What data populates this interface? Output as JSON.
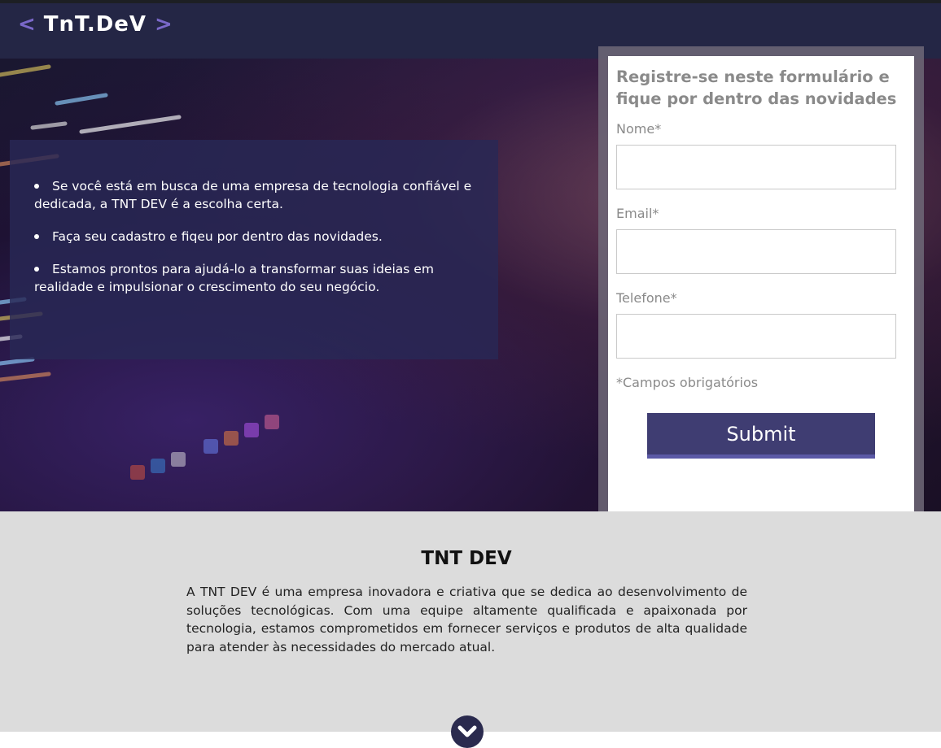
{
  "header": {
    "logo_left_bracket": "<",
    "logo_text": "TnT.DeV",
    "logo_right_bracket": ">"
  },
  "hero": {
    "bullets": [
      "Se você está em busca de uma empresa de tecnologia confiável e dedicada, a TNT DEV é a escolha certa.",
      "Faça seu cadastro e fiqeu por dentro das novidades.",
      "Estamos prontos para ajudá-lo a transformar suas ideias em realidade e impulsionar o crescimento do seu negócio."
    ]
  },
  "form": {
    "title": "Registre-se neste formulário e fique por dentro das novidades",
    "name_label": "Nome*",
    "name_value": "",
    "email_label": "Email*",
    "email_value": "",
    "phone_label": "Telefone*",
    "phone_value": "",
    "required_note": "*Campos obrigatórios",
    "submit_label": "Submit"
  },
  "about": {
    "title": "TNT DEV",
    "text": "A TNT DEV é uma empresa inovadora e criativa que se dedica ao desenvolvimento de soluções tecnológicas. Com uma equipe altamente qualificada e apaixonada por tecnologia, estamos comprometidos em fornecer serviços e produtos de alta qualidade para atender às necessidades do mercado atual."
  },
  "icons": {
    "scroll_down": "chevron-down-icon"
  },
  "colors": {
    "header_bg": "#242645",
    "accent": "#7a68c9",
    "button_bg": "#3f3d72",
    "about_bg": "#dcdcdc"
  }
}
